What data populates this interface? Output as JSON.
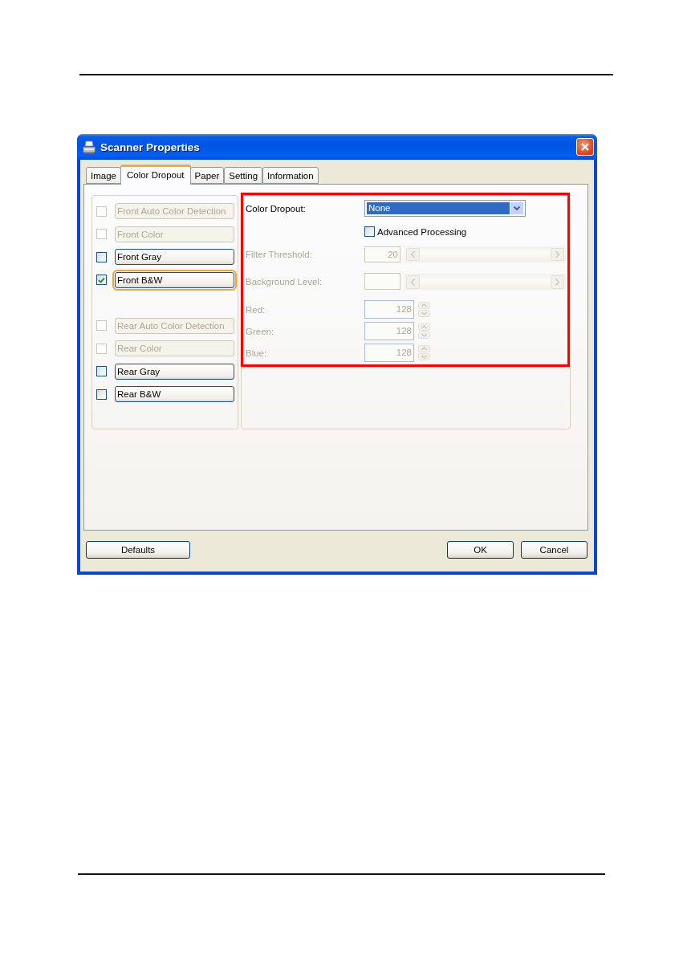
{
  "window": {
    "title": "Scanner Properties"
  },
  "tabs": [
    {
      "label": "Image",
      "selected": false
    },
    {
      "label": "Color Dropout",
      "selected": true
    },
    {
      "label": "Paper",
      "selected": false
    },
    {
      "label": "Setting",
      "selected": false
    },
    {
      "label": "Information",
      "selected": false
    }
  ],
  "image_types": {
    "front": [
      {
        "label": "Front Auto Color Detection",
        "checked": false,
        "disabled": true,
        "focused": false
      },
      {
        "label": "Front Color",
        "checked": false,
        "disabled": true,
        "focused": false
      },
      {
        "label": "Front Gray",
        "checked": false,
        "disabled": false,
        "focused": false
      },
      {
        "label": "Front B&W",
        "checked": true,
        "disabled": false,
        "focused": true
      }
    ],
    "rear": [
      {
        "label": "Rear Auto Color Detection",
        "checked": false,
        "disabled": true,
        "focused": false
      },
      {
        "label": "Rear Color",
        "checked": false,
        "disabled": true,
        "focused": false
      },
      {
        "label": "Rear Gray",
        "checked": false,
        "disabled": false,
        "focused": false
      },
      {
        "label": "Rear B&W",
        "checked": false,
        "disabled": false,
        "focused": false
      }
    ]
  },
  "color_dropout": {
    "label": "Color Dropout:",
    "value": "None",
    "advanced_processing": {
      "label": "Advanced Processing",
      "checked": false
    },
    "filter_threshold": {
      "label": "Filter Threshold:",
      "value": "20",
      "disabled": true
    },
    "background_level": {
      "label": "Background Level:",
      "disabled": true
    },
    "channels": [
      {
        "label": "Red:",
        "value": "128",
        "disabled": true
      },
      {
        "label": "Green:",
        "value": "128",
        "disabled": true
      },
      {
        "label": "Blue:",
        "value": "128",
        "disabled": true
      }
    ]
  },
  "buttons": {
    "left": [
      {
        "label": "Defaults"
      }
    ],
    "right": [
      {
        "label": "OK"
      },
      {
        "label": "Cancel"
      }
    ]
  }
}
